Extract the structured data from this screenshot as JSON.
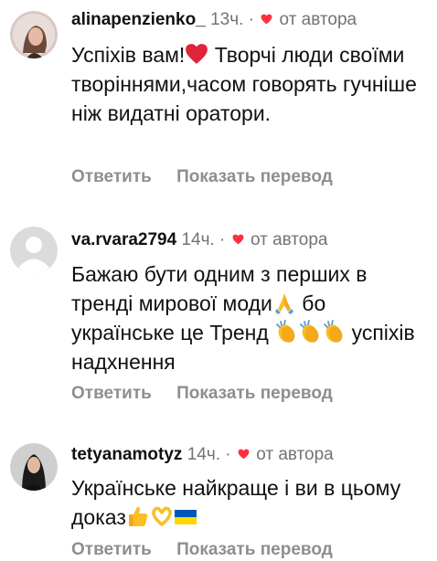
{
  "comments": [
    {
      "username": "alinapenzienko_",
      "time": "13ч.",
      "dot": "·",
      "liked_by_author": "от автора",
      "text_parts": [
        "Успіхів вам!",
        " Творчі люди своїми творіннями,часом говорять гучніше ніж видатні оратори."
      ],
      "emojis": [
        "red-heart-icon"
      ],
      "reply_label": "Ответить",
      "translate_label": "Показать перевод"
    },
    {
      "username": "va.rvara2794",
      "time": "14ч.",
      "dot": "·",
      "liked_by_author": "от автора",
      "text_parts": [
        "Бажаю бути одним з перших в тренді мирової моди",
        " бо українське це Тренд ",
        " успіхів надхнення"
      ],
      "emojis": [
        "folded-hands-icon",
        "clapping-hands-icon",
        "clapping-hands-icon",
        "clapping-hands-icon"
      ],
      "reply_label": "Ответить",
      "translate_label": "Показать перевод"
    },
    {
      "username": "tetyanamotyz",
      "time": "14ч.",
      "dot": "·",
      "liked_by_author": "от автора",
      "text_parts": [
        "Українське найкраще і ви в цьому доказ"
      ],
      "emojis": [
        "thumbs-up-icon",
        "heart-hands-icon",
        "ukraine-flag-icon"
      ],
      "reply_label": "Ответить",
      "translate_label": "Показать перевод"
    }
  ],
  "colors": {
    "heart": "#ff3040",
    "meta_text": "#737373",
    "action_text": "#8e8e8e",
    "emoji_yellow": "#fbbf24",
    "flag_blue": "#0057b7",
    "flag_yellow": "#ffd700"
  }
}
